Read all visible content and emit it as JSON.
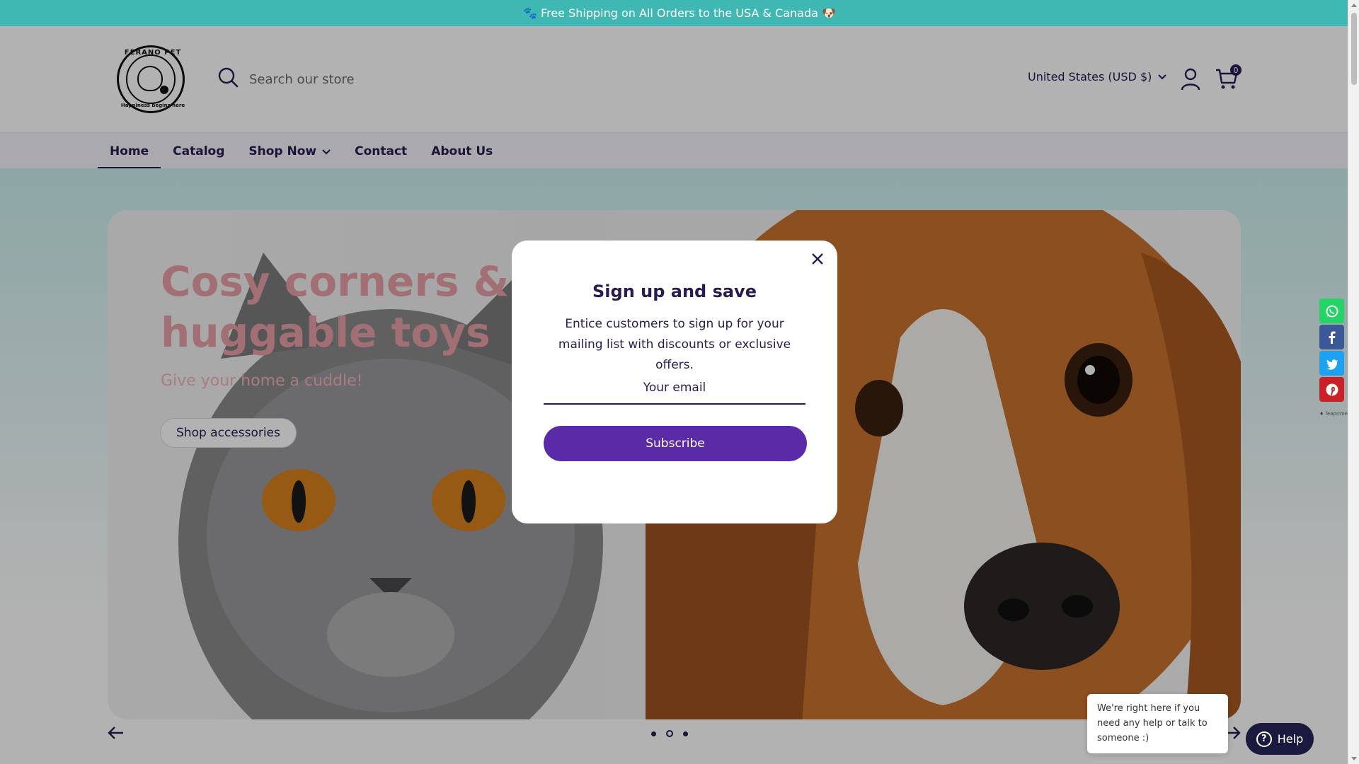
{
  "announcement": {
    "text": "🐾 Free Shipping on All Orders to the USA & Canada 🐶"
  },
  "brand": {
    "logo_top": "FERANO PET",
    "logo_bottom": "Happiness begins here"
  },
  "search": {
    "placeholder": "Search our store"
  },
  "header": {
    "currency": "United States (USD $)",
    "cart_count": "0"
  },
  "nav": {
    "items": [
      {
        "label": "Home",
        "active": true
      },
      {
        "label": "Catalog"
      },
      {
        "label": "Shop Now",
        "has_dropdown": true
      },
      {
        "label": "Contact"
      },
      {
        "label": "About Us"
      }
    ]
  },
  "hero": {
    "title": "Cosy corners & huggable toys",
    "subtitle": "Give your home a cuddle!",
    "button": "Shop accessories",
    "active_slide": 2,
    "slide_count": 3
  },
  "popup": {
    "title": "Sign up and save",
    "text": "Entice customers to sign up for your mailing list with discounts or exclusive offers.",
    "email_placeholder": "Your email",
    "button": "Subscribe"
  },
  "share": {
    "items": [
      {
        "icon": "whatsapp-icon",
        "color": "#25d366"
      },
      {
        "icon": "facebook-icon",
        "color": "#3b5998"
      },
      {
        "icon": "twitter-icon",
        "color": "#1da1f2"
      },
      {
        "icon": "pinterest-icon",
        "color": "#cb2027"
      }
    ],
    "credit": "♦ feaprime"
  },
  "chat": {
    "bubble": "We're right here if you need any help or talk to someone :)",
    "button": "Help"
  },
  "colors": {
    "announcement_bg": "#3fb7b3",
    "brand_dark": "#2a1b52",
    "subscribe_bg": "#5b2aa6",
    "help_bg": "#1a1a3e"
  }
}
